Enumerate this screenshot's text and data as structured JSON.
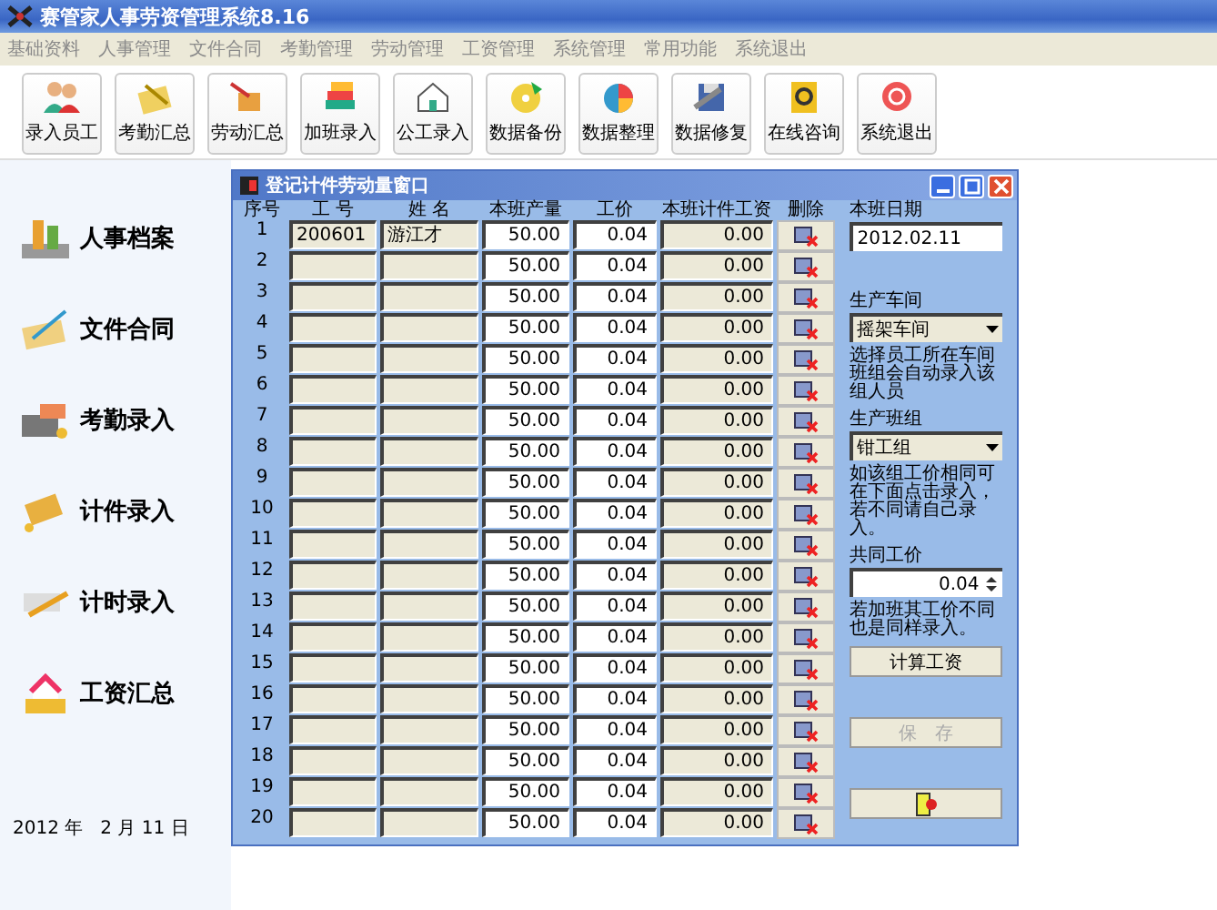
{
  "window": {
    "title": "赛管家人事劳资管理系统8.16"
  },
  "menu": [
    "基础资料",
    "人事管理",
    "文件合同",
    "考勤管理",
    "劳动管理",
    "工资管理",
    "系统管理",
    "常用功能",
    "系统退出"
  ],
  "toolbar": [
    "录入员工",
    "考勤汇总",
    "劳动汇总",
    "加班录入",
    "公工录入",
    "数据备份",
    "数据整理",
    "数据修复",
    "在线咨询",
    "系统退出"
  ],
  "sidebar": {
    "items": [
      "人事档案",
      "文件合同",
      "考勤录入",
      "计件录入",
      "计时录入",
      "工资汇总"
    ],
    "date": "2012 年   2 月 11 日"
  },
  "dialog": {
    "title": "登记计件劳动量窗口",
    "columns": [
      "序号",
      "工 号",
      "姓 名",
      "本班产量",
      "工价",
      "本班计件工资",
      "删除"
    ],
    "rows": [
      {
        "seq": "1",
        "emp_id": "200601",
        "name": "游江才",
        "output": "50.00",
        "rate": "0.04",
        "wage": "0.00"
      },
      {
        "seq": "2",
        "output": "50.00",
        "rate": "0.04",
        "wage": "0.00"
      },
      {
        "seq": "3",
        "output": "50.00",
        "rate": "0.04",
        "wage": "0.00"
      },
      {
        "seq": "4",
        "output": "50.00",
        "rate": "0.04",
        "wage": "0.00"
      },
      {
        "seq": "5",
        "output": "50.00",
        "rate": "0.04",
        "wage": "0.00"
      },
      {
        "seq": "6",
        "output": "50.00",
        "rate": "0.04",
        "wage": "0.00"
      },
      {
        "seq": "7",
        "output": "50.00",
        "rate": "0.04",
        "wage": "0.00"
      },
      {
        "seq": "8",
        "output": "50.00",
        "rate": "0.04",
        "wage": "0.00"
      },
      {
        "seq": "9",
        "output": "50.00",
        "rate": "0.04",
        "wage": "0.00"
      },
      {
        "seq": "10",
        "output": "50.00",
        "rate": "0.04",
        "wage": "0.00"
      },
      {
        "seq": "11",
        "output": "50.00",
        "rate": "0.04",
        "wage": "0.00"
      },
      {
        "seq": "12",
        "output": "50.00",
        "rate": "0.04",
        "wage": "0.00"
      },
      {
        "seq": "13",
        "output": "50.00",
        "rate": "0.04",
        "wage": "0.00"
      },
      {
        "seq": "14",
        "output": "50.00",
        "rate": "0.04",
        "wage": "0.00"
      },
      {
        "seq": "15",
        "output": "50.00",
        "rate": "0.04",
        "wage": "0.00"
      },
      {
        "seq": "16",
        "output": "50.00",
        "rate": "0.04",
        "wage": "0.00"
      },
      {
        "seq": "17",
        "output": "50.00",
        "rate": "0.04",
        "wage": "0.00"
      },
      {
        "seq": "18",
        "output": "50.00",
        "rate": "0.04",
        "wage": "0.00"
      },
      {
        "seq": "19",
        "output": "50.00",
        "rate": "0.04",
        "wage": "0.00"
      },
      {
        "seq": "20",
        "output": "50.00",
        "rate": "0.04",
        "wage": "0.00"
      }
    ],
    "panel": {
      "date_label": "本班日期",
      "date": "2012.02.11",
      "workshop_label": "生产车间",
      "workshop": "摇架车间",
      "workshop_hint": "选择员工所在车间班组会自动录入该组人员",
      "team_label": "生产班组",
      "team": "钳工组",
      "team_hint": "如该组工价相同可在下面点击录入，若不同请自己录入。",
      "rate_label": "共同工价",
      "rate": "0.04",
      "rate_hint": "若加班其工价不同也是同样录入。",
      "calc_button": "计算工资",
      "save_button": {
        "label": "保　存",
        "disabled": true
      }
    }
  }
}
